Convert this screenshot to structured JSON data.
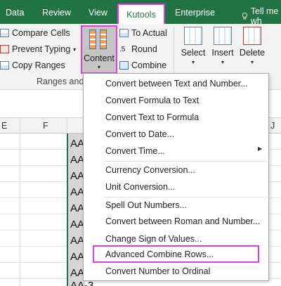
{
  "tabs": {
    "data": "Data",
    "review": "Review",
    "view": "View",
    "kutools": "Kutools",
    "enterprise": "Enterprise",
    "tell_me": "Tell me wh"
  },
  "ribbon": {
    "compare_cells": "Compare Cells",
    "prevent_typing": "Prevent Typing",
    "copy_ranges": "Copy Ranges",
    "content": "Content",
    "to_actual": "To Actual",
    "round": "Round",
    "combine": "Combine",
    "select": "Select",
    "insert": "Insert",
    "delete": "Delete",
    "group_label": "Ranges and"
  },
  "sheet": {
    "col_e": "E",
    "col_f": "F",
    "col_j": "J",
    "cells": [
      "AA",
      "AA",
      "AA",
      "AA",
      "AA",
      "AA",
      "AA",
      "AA",
      "AA",
      "AA-3"
    ]
  },
  "menu": {
    "items": [
      "Convert between Text and Number...",
      "Convert Formula to Text",
      "Convert Text to Formula",
      "Convert to Date...",
      "Convert Time...",
      "Currency Conversion...",
      "Unit Conversion...",
      "Spell Out Numbers...",
      "Convert between Roman and Number...",
      "Change Sign of Values...",
      "Advanced Combine Rows...",
      "Convert Number to Ordinal"
    ]
  },
  "colors": {
    "ribbon_green": "#217346",
    "highlight_magenta": "#e03ddd"
  }
}
